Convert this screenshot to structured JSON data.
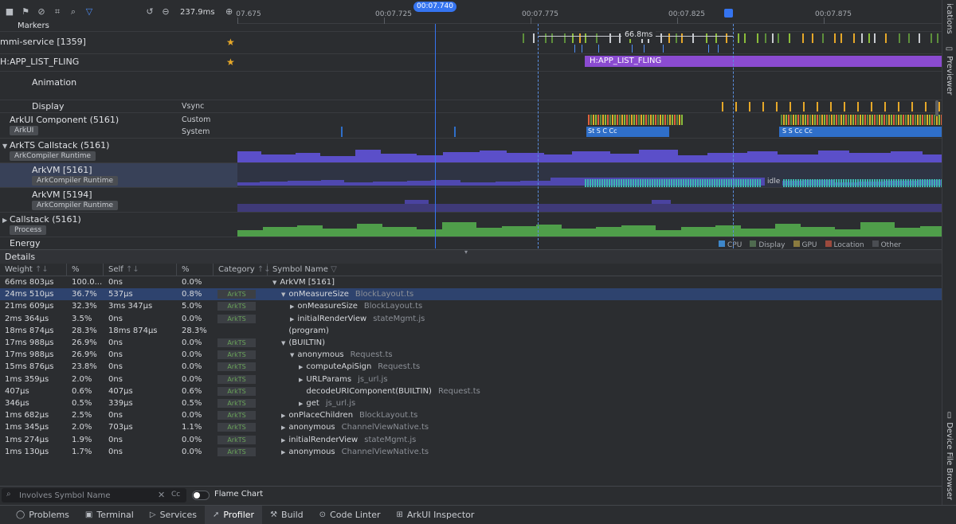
{
  "toolbar": {
    "zoom": "237.9ms",
    "icons": [
      "stop-icon",
      "flag-icon",
      "cancel-icon",
      "crop-icon",
      "search-icon",
      "filter-icon",
      "reset-icon",
      "zoom-out-icon",
      "zoom-in-icon"
    ]
  },
  "ruler": {
    "ticks": [
      "07.675",
      "00:07.725",
      "00:07.775",
      "00:07.825",
      "00:07.875"
    ],
    "cursor": "00:07.740",
    "range": "66.8ms"
  },
  "lanes": {
    "markers": "Markers",
    "service": "mmi-service [1359]",
    "fling": "H:APP_LIST_FLING",
    "fling_bar": "H:APP_LIST_FLING",
    "animation": "Animation",
    "display": "Display",
    "vsync": "Vsync",
    "arkui": "ArkUI Component (5161)",
    "arkui_tag": "ArkUI",
    "custom": "Custom",
    "system": "System",
    "arkts": "ArkTS Callstack (5161)",
    "arkts_tag": "ArkCompiler Runtime",
    "arkvm1": "ArkVM [5161]",
    "arkvm1_tag": "ArkCompiler Runtime",
    "arkvm2": "ArkVM [5194]",
    "arkvm2_tag": "ArkCompiler Runtime",
    "callstack": "Callstack (5161)",
    "callstack_tag": "Process",
    "energy": "Energy",
    "idle": "idle",
    "legend": [
      "CPU",
      "Display",
      "GPU",
      "Location",
      "Other"
    ],
    "legend_colors": [
      "#3e87c9",
      "#4f6b4f",
      "#8a7b3f",
      "#9c4a3d",
      "#4a4d52"
    ]
  },
  "right_sidebar": [
    "ications",
    "Previewer",
    "Device File Browser"
  ],
  "details": {
    "title": "Details",
    "columns": [
      "Weight",
      "%",
      "Self",
      "%",
      "Category",
      "Symbol Name"
    ],
    "rows": [
      {
        "w": "66ms 803μs",
        "wp": "100.0...",
        "s": "0ns",
        "sp": "0.0%",
        "cat": "",
        "sym": "ArkVM [5161]",
        "file": "",
        "depth": 0,
        "tri": "▼"
      },
      {
        "w": "24ms 510μs",
        "wp": "36.7%",
        "s": "537μs",
        "sp": "0.8%",
        "cat": "ArkTS",
        "sym": "onMeasureSize",
        "file": "BlockLayout.ts",
        "depth": 1,
        "tri": "▼"
      },
      {
        "w": "21ms 609μs",
        "wp": "32.3%",
        "s": "3ms 347μs",
        "sp": "5.0%",
        "cat": "ArkTS",
        "sym": "onMeasureSize",
        "file": "BlockLayout.ts",
        "depth": 2,
        "tri": "▶"
      },
      {
        "w": "2ms 364μs",
        "wp": "3.5%",
        "s": "0ns",
        "sp": "0.0%",
        "cat": "ArkTS",
        "sym": "initialRenderView",
        "file": "stateMgmt.js",
        "depth": 2,
        "tri": "▶"
      },
      {
        "w": "18ms 874μs",
        "wp": "28.3%",
        "s": "18ms 874μs",
        "sp": "28.3%",
        "cat": "",
        "sym": "(program)",
        "file": "",
        "depth": 1,
        "tri": ""
      },
      {
        "w": "17ms 988μs",
        "wp": "26.9%",
        "s": "0ns",
        "sp": "0.0%",
        "cat": "ArkTS",
        "sym": "(BUILTIN)",
        "file": "",
        "depth": 1,
        "tri": "▼"
      },
      {
        "w": "17ms 988μs",
        "wp": "26.9%",
        "s": "0ns",
        "sp": "0.0%",
        "cat": "ArkTS",
        "sym": "anonymous",
        "file": "Request.ts",
        "depth": 2,
        "tri": "▼"
      },
      {
        "w": "15ms 876μs",
        "wp": "23.8%",
        "s": "0ns",
        "sp": "0.0%",
        "cat": "ArkTS",
        "sym": "computeApiSign",
        "file": "Request.ts",
        "depth": 3,
        "tri": "▶"
      },
      {
        "w": "1ms 359μs",
        "wp": "2.0%",
        "s": "0ns",
        "sp": "0.0%",
        "cat": "ArkTS",
        "sym": "URLParams",
        "file": "js_url.js",
        "depth": 3,
        "tri": "▶"
      },
      {
        "w": "407μs",
        "wp": "0.6%",
        "s": "407μs",
        "sp": "0.6%",
        "cat": "ArkTS",
        "sym": "decodeURIComponent(BUILTIN)",
        "file": "Request.ts",
        "depth": 3,
        "tri": ""
      },
      {
        "w": "346μs",
        "wp": "0.5%",
        "s": "339μs",
        "sp": "0.5%",
        "cat": "ArkTS",
        "sym": "get",
        "file": "js_url.js",
        "depth": 3,
        "tri": "▶"
      },
      {
        "w": "1ms 682μs",
        "wp": "2.5%",
        "s": "0ns",
        "sp": "0.0%",
        "cat": "ArkTS",
        "sym": "onPlaceChildren",
        "file": "BlockLayout.ts",
        "depth": 1,
        "tri": "▶"
      },
      {
        "w": "1ms 345μs",
        "wp": "2.0%",
        "s": "703μs",
        "sp": "1.1%",
        "cat": "ArkTS",
        "sym": "anonymous",
        "file": "ChannelViewNative.ts",
        "depth": 1,
        "tri": "▶"
      },
      {
        "w": "1ms 274μs",
        "wp": "1.9%",
        "s": "0ns",
        "sp": "0.0%",
        "cat": "ArkTS",
        "sym": "initialRenderView",
        "file": "stateMgmt.js",
        "depth": 1,
        "tri": "▶"
      },
      {
        "w": "1ms 130μs",
        "wp": "1.7%",
        "s": "0ns",
        "sp": "0.0%",
        "cat": "ArkTS",
        "sym": "anonymous",
        "file": "ChannelViewNative.ts",
        "depth": 1,
        "tri": "▶"
      }
    ]
  },
  "search": {
    "placeholder": "Involves Symbol Name",
    "case_label": "Cc",
    "flame_label": "Flame Chart"
  },
  "bottom_tabs": [
    {
      "label": "Problems",
      "icon": "problems-icon",
      "glyph": "◯"
    },
    {
      "label": "Terminal",
      "icon": "terminal-icon",
      "glyph": "▣"
    },
    {
      "label": "Services",
      "icon": "services-icon",
      "glyph": "▷"
    },
    {
      "label": "Profiler",
      "icon": "profiler-icon",
      "glyph": "➚"
    },
    {
      "label": "Build",
      "icon": "build-icon",
      "glyph": "⚒"
    },
    {
      "label": "Code Linter",
      "icon": "code-linter-icon",
      "glyph": "⊙"
    },
    {
      "label": "ArkUI Inspector",
      "icon": "arkui-inspector-icon",
      "glyph": "⊞"
    }
  ]
}
